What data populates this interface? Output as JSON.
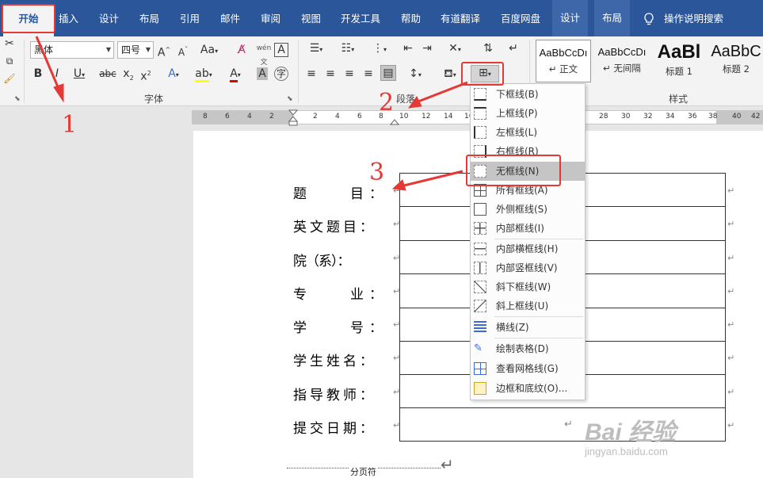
{
  "tabs": [
    "开始",
    "插入",
    "设计",
    "布局",
    "引用",
    "邮件",
    "审阅",
    "视图",
    "开发工具",
    "帮助",
    "有道翻译",
    "百度网盘"
  ],
  "context_tabs": [
    "设计",
    "布局"
  ],
  "search_tell": "操作说明搜索",
  "font": {
    "name": "黑体",
    "size": "四号",
    "case_label": "Aa"
  },
  "groups": {
    "font": "字体",
    "paragraph": "段落",
    "styles": "样式"
  },
  "styles": [
    {
      "sample": "AaBbCcDı",
      "name": "↵ 正文"
    },
    {
      "sample": "AaBbCcDı",
      "name": "↵ 无间隔"
    },
    {
      "sample": "AaBl",
      "name": "标题 1"
    },
    {
      "sample": "AaBbC",
      "name": "标题 2"
    }
  ],
  "ruler": [
    "8",
    "6",
    "4",
    "2",
    "2",
    "4",
    "6",
    "8",
    "10",
    "12",
    "14",
    "16",
    "28",
    "30",
    "32",
    "34",
    "36",
    "38",
    "40",
    "42"
  ],
  "form_labels": [
    "题　　目：",
    "英文题目：",
    "院（系）：",
    "专　　业：",
    "学　　号：",
    "学生姓名：",
    "指导教师：",
    "提交日期："
  ],
  "page_break": "分页符",
  "border_menu": [
    {
      "label": "下框线(B)",
      "icon": "bottom-border-icon"
    },
    {
      "label": "上框线(P)",
      "icon": "top-border-icon"
    },
    {
      "label": "左框线(L)",
      "icon": "left-border-icon"
    },
    {
      "label": "右框线(R)",
      "icon": "right-border-icon"
    },
    {
      "label": "无框线(N)",
      "icon": "no-border-icon",
      "highlight": true
    },
    {
      "label": "所有框线(A)",
      "icon": "all-borders-icon"
    },
    {
      "label": "外侧框线(S)",
      "icon": "outside-borders-icon"
    },
    {
      "label": "内部框线(I)",
      "icon": "inside-borders-icon"
    },
    {
      "label": "内部横框线(H)",
      "icon": "inside-horizontal-border-icon"
    },
    {
      "label": "内部竖框线(V)",
      "icon": "inside-vertical-border-icon"
    },
    {
      "label": "斜下框线(W)",
      "icon": "diagonal-down-border-icon"
    },
    {
      "label": "斜上框线(U)",
      "icon": "diagonal-up-border-icon"
    },
    {
      "label": "横线(Z)",
      "icon": "horizontal-line-icon"
    },
    {
      "label": "绘制表格(D)",
      "icon": "draw-table-icon"
    },
    {
      "label": "查看网格线(G)",
      "icon": "view-gridlines-icon"
    },
    {
      "label": "边框和底纹(O)...",
      "icon": "borders-shading-icon"
    }
  ],
  "annotations": [
    "1",
    "2",
    "3"
  ],
  "watermark": {
    "logo": "Bai 经验",
    "url": "jingyan.baidu.com"
  },
  "colors": {
    "accent": "#2b579a",
    "annotation": "#e53935"
  }
}
